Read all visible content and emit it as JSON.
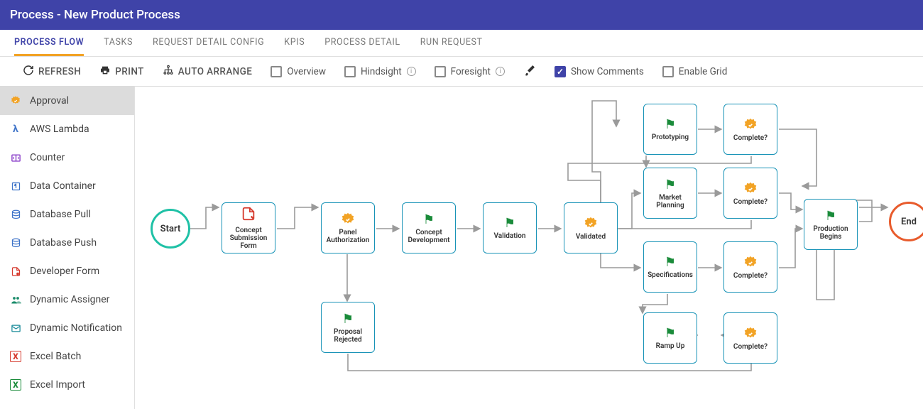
{
  "header": {
    "title": "Process - New Product Process"
  },
  "tabs": [
    {
      "label": "PROCESS FLOW",
      "active": true
    },
    {
      "label": "TASKS"
    },
    {
      "label": "REQUEST DETAIL CONFIG"
    },
    {
      "label": "KPIS"
    },
    {
      "label": "PROCESS DETAIL"
    },
    {
      "label": "RUN REQUEST"
    }
  ],
  "toolbar": {
    "refresh": "REFRESH",
    "print": "PRINT",
    "auto_arrange": "AUTO ARRANGE",
    "checks": {
      "overview": {
        "label": "Overview",
        "checked": false
      },
      "hindsight": {
        "label": "Hindsight",
        "checked": false
      },
      "foresight": {
        "label": "Foresight",
        "checked": false
      },
      "comments": {
        "label": "Show Comments",
        "checked": true
      },
      "grid": {
        "label": "Enable Grid",
        "checked": false
      }
    }
  },
  "palette": [
    {
      "label": "Approval",
      "icon": "approval",
      "color": "#f2a325",
      "selected": true
    },
    {
      "label": "AWS Lambda",
      "icon": "lambda",
      "color": "#3f74c9"
    },
    {
      "label": "Counter",
      "icon": "counter",
      "color": "#8a3fc9"
    },
    {
      "label": "Data Container",
      "icon": "container",
      "color": "#3f74c9"
    },
    {
      "label": "Database Pull",
      "icon": "dbpull",
      "color": "#3f74c9"
    },
    {
      "label": "Database Push",
      "icon": "dbpush",
      "color": "#3f74c9"
    },
    {
      "label": "Developer Form",
      "icon": "devform",
      "color": "#d63a2e"
    },
    {
      "label": "Dynamic Assigner",
      "icon": "assigner",
      "color": "#1a8b6a"
    },
    {
      "label": "Dynamic Notification",
      "icon": "notify",
      "color": "#1a8b9a"
    },
    {
      "label": "Excel Batch",
      "icon": "xlbatch",
      "color": "#d63a2e"
    },
    {
      "label": "Excel Import",
      "icon": "xlimport",
      "color": "#1a8b3a"
    }
  ],
  "nodes": {
    "start": "Start",
    "end": "End",
    "concept_sub": "Concept Submission Form",
    "panel_auth": "Panel Authorization",
    "concept_dev": "Concept Development",
    "validation": "Validation",
    "validated": "Validated",
    "proposal_rej": "Proposal Rejected",
    "prototyping": "Prototyping",
    "market_plan": "Market Planning",
    "specs": "Specifications",
    "complete1": "Complete?",
    "complete2": "Complete?",
    "complete3": "Complete?",
    "ramp_up": "Ramp Up",
    "complete4": "Complete?",
    "production": "Production Begins"
  }
}
